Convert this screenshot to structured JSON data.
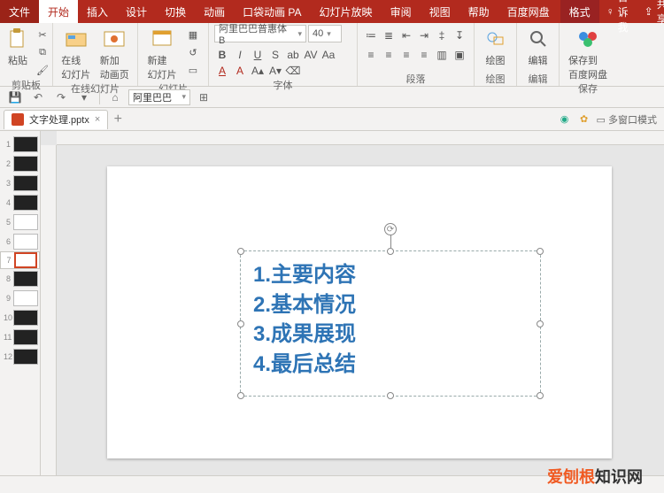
{
  "tabs": {
    "file": "文件",
    "home": "开始",
    "insert": "插入",
    "design": "设计",
    "transitions": "切换",
    "animations": "动画",
    "pocket": "口袋动画 PA",
    "slideshow": "幻灯片放映",
    "review": "审阅",
    "view": "视图",
    "help": "帮助",
    "netdisk": "百度网盘",
    "format": "格式",
    "tellme": "告诉我",
    "share": "共享"
  },
  "ribbon": {
    "clipboard": {
      "label": "剪贴板",
      "paste": "粘贴"
    },
    "onlineSlides": {
      "label": "在线幻灯片",
      "online": "在线\n幻灯片",
      "newanim": "新加\n动画页"
    },
    "slides": {
      "label": "幻灯片",
      "new": "新建\n幻灯片"
    },
    "font": {
      "label": "字体",
      "name": "阿里巴巴普惠体 B",
      "size": "40"
    },
    "paragraph": {
      "label": "段落"
    },
    "drawing": {
      "label": "绘图",
      "btn": "绘图"
    },
    "editing": {
      "label": "编辑",
      "btn": "编辑"
    },
    "save": {
      "label": "保存",
      "btn": "保存到\n百度网盘"
    }
  },
  "secbar": {
    "zoomFont": "阿里巴巴"
  },
  "doc": {
    "title": "文字处理.pptx"
  },
  "rightdoc": {
    "multi": "多窗口模式"
  },
  "slides_list": [
    {
      "n": "1",
      "cls": ""
    },
    {
      "n": "2",
      "cls": ""
    },
    {
      "n": "3",
      "cls": ""
    },
    {
      "n": "4",
      "cls": ""
    },
    {
      "n": "5",
      "cls": "grid"
    },
    {
      "n": "6",
      "cls": "grid"
    },
    {
      "n": "7",
      "cls": "sel white"
    },
    {
      "n": "8",
      "cls": ""
    },
    {
      "n": "9",
      "cls": "white"
    },
    {
      "n": "10",
      "cls": ""
    },
    {
      "n": "11",
      "cls": ""
    },
    {
      "n": "12",
      "cls": ""
    }
  ],
  "textbox": {
    "lines": [
      "1.主要内容",
      "2.基本情况",
      "3.成果展现",
      "4.最后总结"
    ]
  },
  "watermark": {
    "a": "爱刨根",
    "b": "知识网"
  }
}
